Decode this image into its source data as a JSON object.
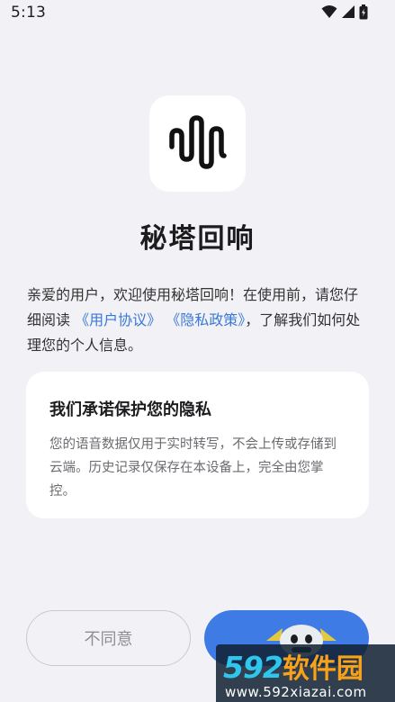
{
  "status_bar": {
    "time": "5:13",
    "icons": [
      "wifi-icon",
      "signal-icon",
      "battery-icon"
    ]
  },
  "app": {
    "icon": "waveform-logo-icon",
    "title": "秘塔回响"
  },
  "intro": {
    "text_before": "亲爱的用户，欢迎使用秘塔回响！在使用前，请您仔细阅读",
    "user_agreement_link": "《用户协议》",
    "privacy_policy_link": "《隐私政策》",
    "text_after": "，了解我们如何处理您的个人信息。"
  },
  "privacy_card": {
    "title": "我们承诺保护您的隐私",
    "body": "您的语音数据仅用于实时转写，不会上传或存储到云端。历史记录仅保存在本设备上，完全由您掌控。"
  },
  "buttons": {
    "decline_label": "不同意"
  },
  "watermark": {
    "brand_number": "592",
    "brand_text": "软件园",
    "url": "www.592xiazai.com"
  },
  "colors": {
    "background": "#f2f2f6",
    "link": "#3a78d6",
    "primary_button": "#3f7be4",
    "card": "#ffffff"
  }
}
